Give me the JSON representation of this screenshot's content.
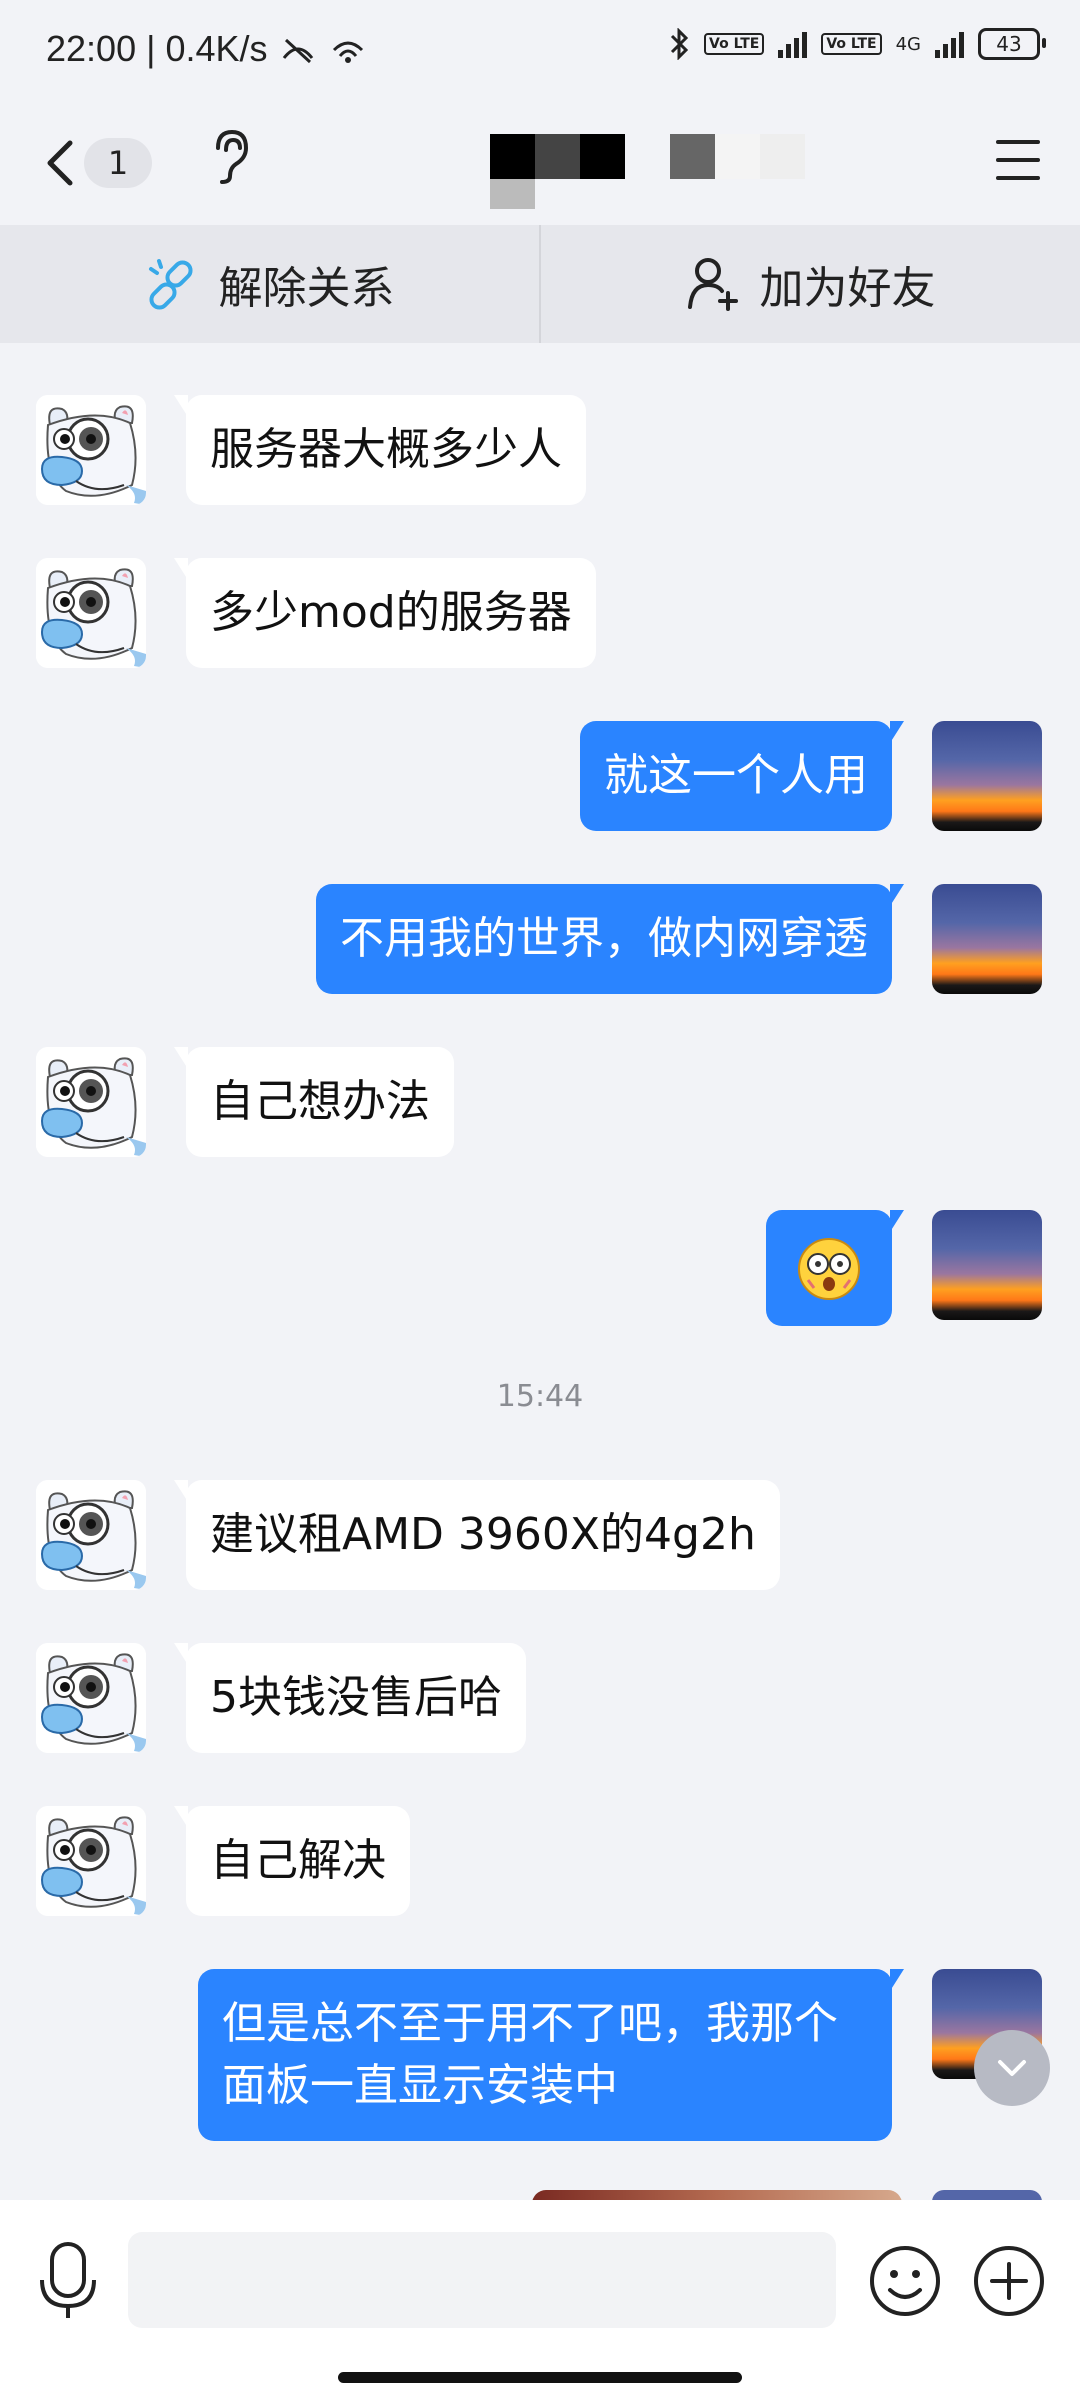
{
  "status_bar": {
    "time": "22:00",
    "net_speed": "0.4K/s",
    "network": "4G",
    "volte": "Vo LTE",
    "battery": "43"
  },
  "header": {
    "back_icon": "chevron-left-icon",
    "unread_count": "1",
    "ear_icon": "ear-icon",
    "menu_icon": "menu-icon"
  },
  "actions": {
    "unbind": {
      "label": "解除关系",
      "icon": "unlink-icon"
    },
    "add_friend": {
      "label": "加为好友",
      "icon": "add-user-icon"
    }
  },
  "messages": [
    {
      "side": "in",
      "text": "服务器大概多少人"
    },
    {
      "side": "in",
      "text": "多少mod的服务器"
    },
    {
      "side": "out",
      "text": "就这一个人用"
    },
    {
      "side": "out",
      "text": "不用我的世界，做内网穿透"
    },
    {
      "side": "in",
      "text": "自己想办法"
    },
    {
      "side": "out",
      "text": "",
      "emoji": "shocked-face-emoji"
    },
    {
      "side": "time",
      "text": "15:44"
    },
    {
      "side": "in",
      "text": "建议租AMD 3960X的4g2h"
    },
    {
      "side": "in",
      "text": "5块钱没售后哈"
    },
    {
      "side": "in",
      "text": "自己解决"
    },
    {
      "side": "out",
      "text": "但是总不至于用不了吧，我那个\n面板一直显示安装中"
    }
  ],
  "input": {
    "placeholder": "",
    "mic_icon": "microphone-icon",
    "emoji_icon": "smiley-icon",
    "plus_icon": "plus-circle-icon"
  },
  "colors": {
    "accent": "#2a84ff",
    "background": "#f2f3f7",
    "incoming_bubble": "#ffffff"
  }
}
